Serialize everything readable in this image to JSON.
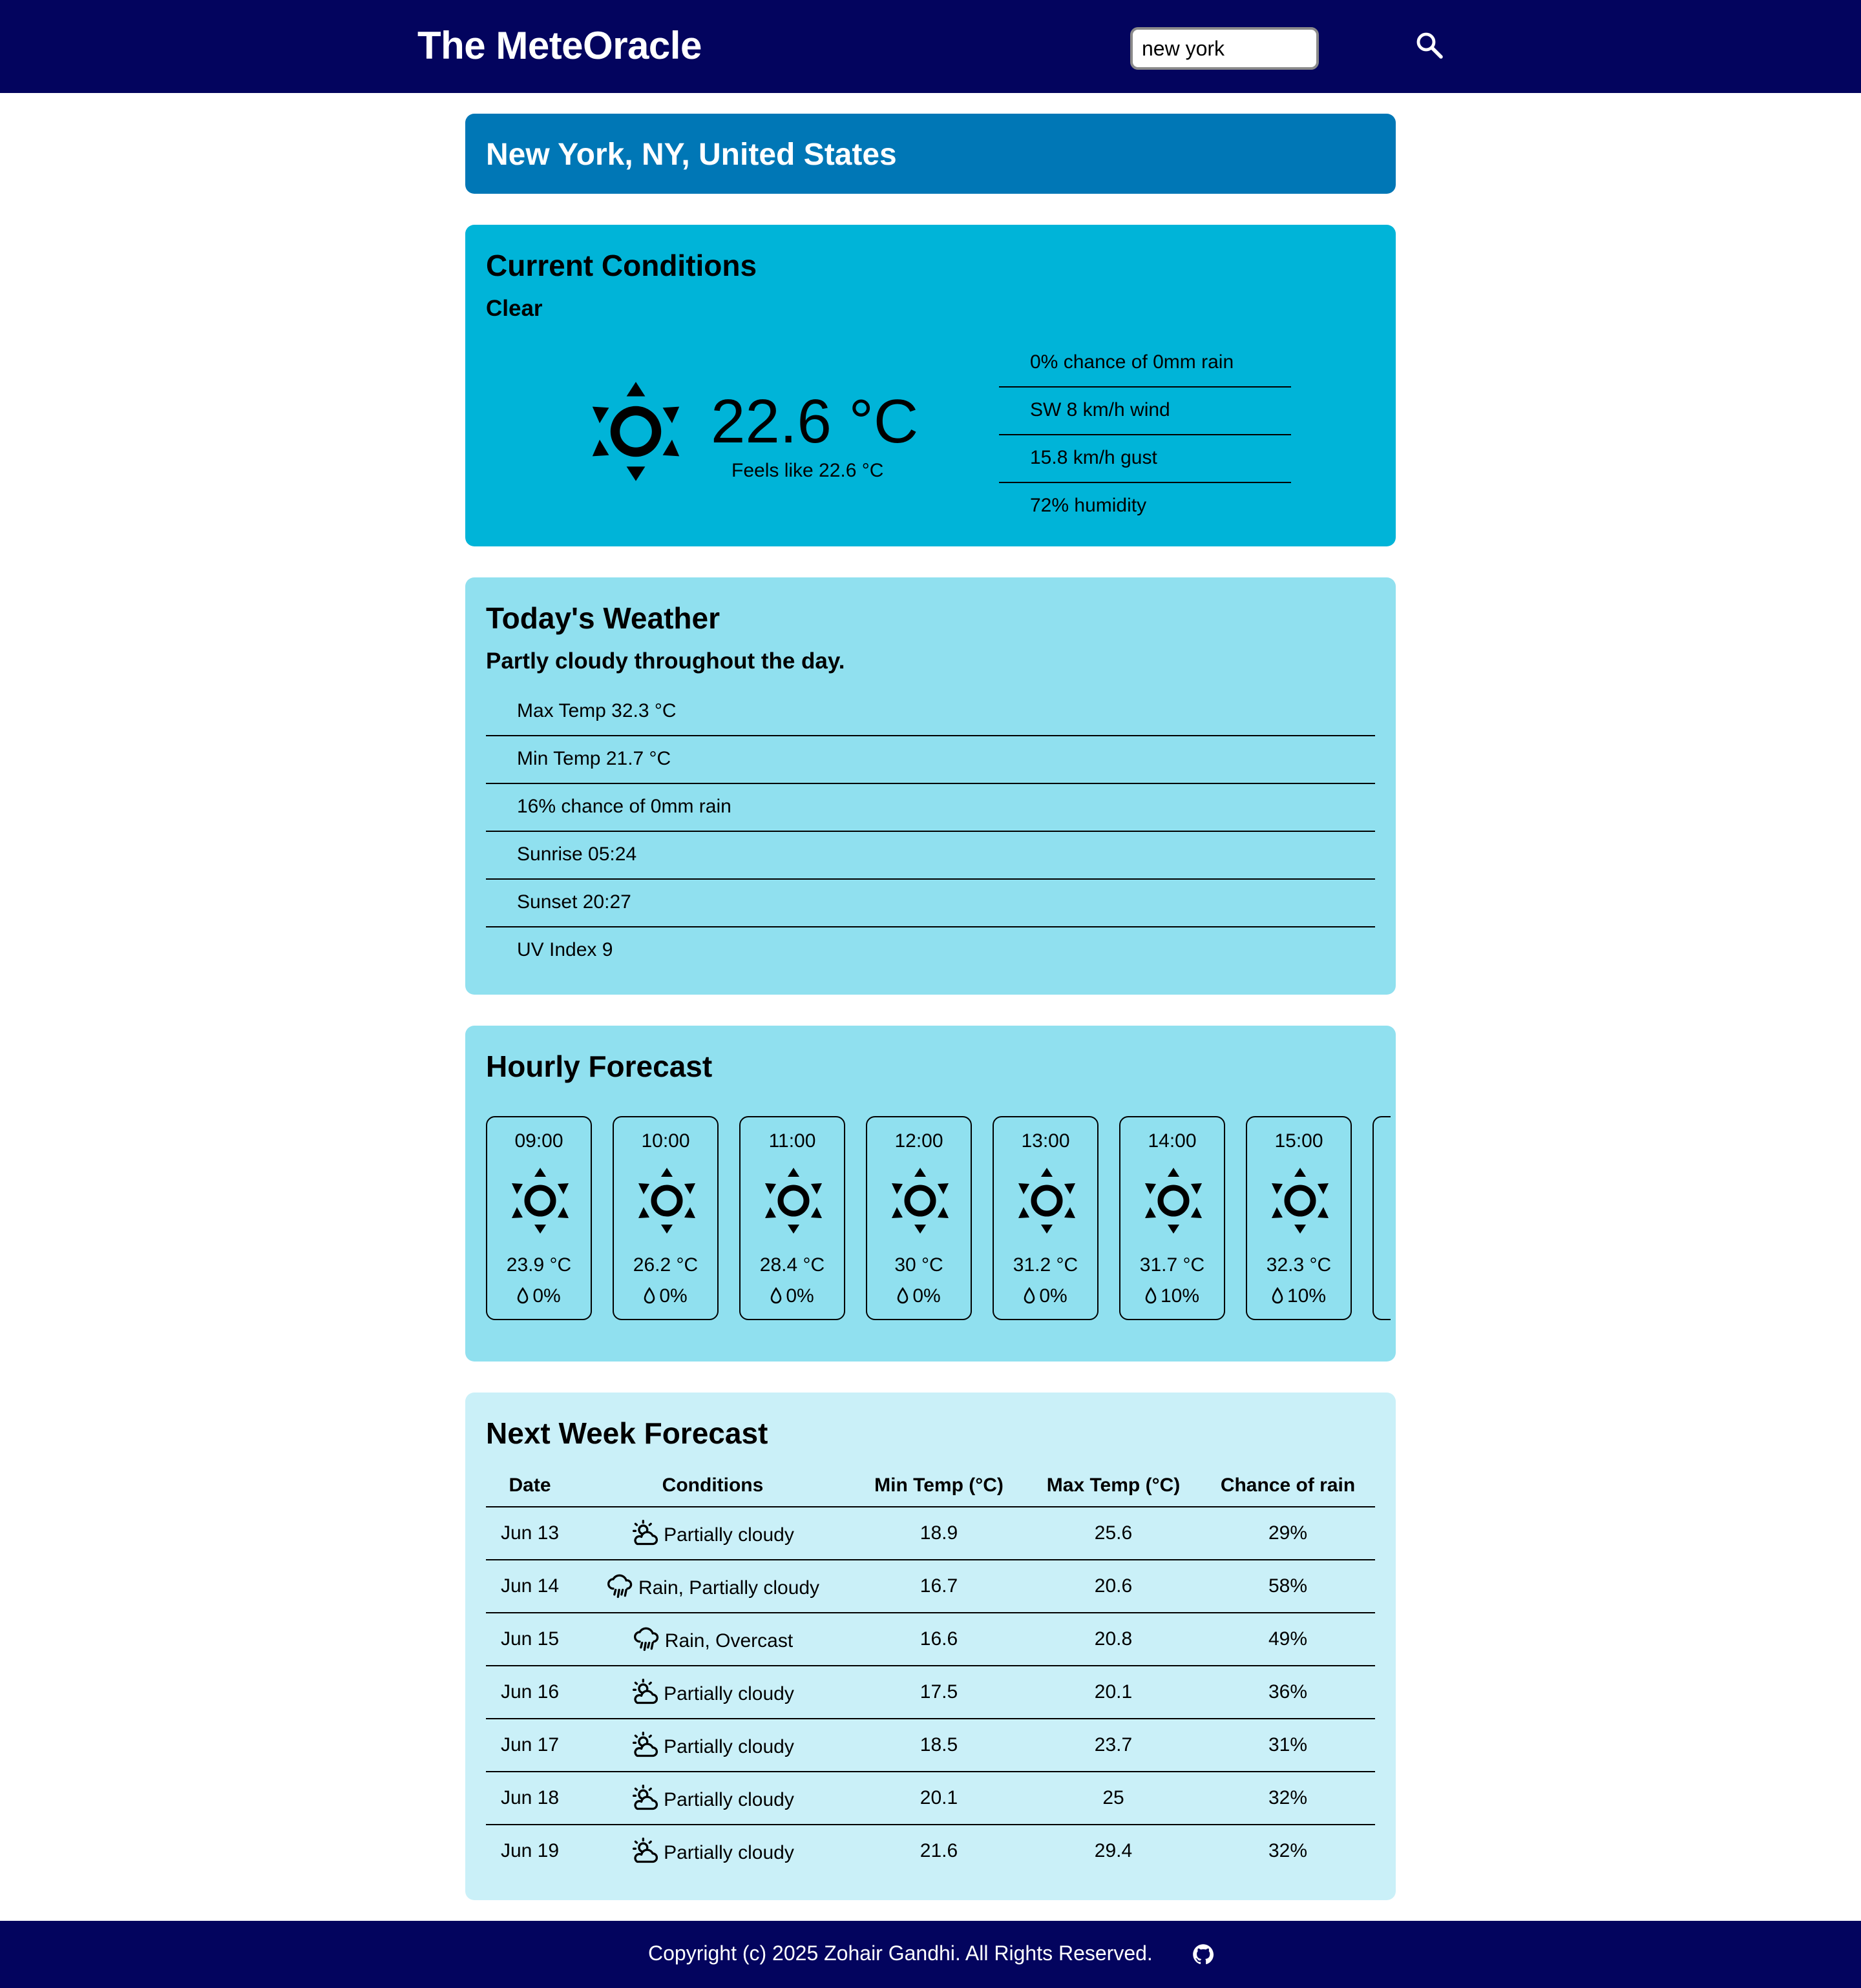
{
  "header": {
    "brand": "The MeteOracle",
    "search_value": "new york",
    "search_icon": "search-icon"
  },
  "location": "New York, NY, United States",
  "current": {
    "title": "Current Conditions",
    "condition": "Clear",
    "icon": "sun-icon",
    "temp": "22.6 °C",
    "feels_like": "Feels like 22.6 °C",
    "details": [
      "0% chance of 0mm rain",
      "SW 8 km/h wind",
      "15.8 km/h gust",
      "72% humidity"
    ]
  },
  "today": {
    "title": "Today's Weather",
    "summary": "Partly cloudy throughout the day.",
    "details": [
      "Max Temp 32.3 °C",
      "Min Temp 21.7 °C",
      "16% chance of 0mm rain",
      "Sunrise 05:24",
      "Sunset 20:27",
      "UV Index 9"
    ]
  },
  "hourly": {
    "title": "Hourly Forecast",
    "hours": [
      {
        "time": "09:00",
        "temp": "23.9 °C",
        "rain": "0%",
        "icon": "sun-icon"
      },
      {
        "time": "10:00",
        "temp": "26.2 °C",
        "rain": "0%",
        "icon": "sun-icon"
      },
      {
        "time": "11:00",
        "temp": "28.4 °C",
        "rain": "0%",
        "icon": "sun-icon"
      },
      {
        "time": "12:00",
        "temp": "30 °C",
        "rain": "0%",
        "icon": "sun-icon"
      },
      {
        "time": "13:00",
        "temp": "31.2 °C",
        "rain": "0%",
        "icon": "sun-icon"
      },
      {
        "time": "14:00",
        "temp": "31.7 °C",
        "rain": "10%",
        "icon": "sun-icon"
      },
      {
        "time": "15:00",
        "temp": "32.3 °C",
        "rain": "10%",
        "icon": "sun-icon"
      }
    ]
  },
  "week": {
    "title": "Next Week Forecast",
    "headers": [
      "Date",
      "Conditions",
      "Min Temp (°C)",
      "Max Temp (°C)",
      "Chance of rain"
    ],
    "rows": [
      {
        "date": "Jun 13",
        "icon": "partly-cloudy-icon",
        "conditions": "Partially cloudy",
        "min": "18.9",
        "max": "25.6",
        "rain": "29%"
      },
      {
        "date": "Jun 14",
        "icon": "rain-icon",
        "conditions": "Rain, Partially cloudy",
        "min": "16.7",
        "max": "20.6",
        "rain": "58%"
      },
      {
        "date": "Jun 15",
        "icon": "rain-icon",
        "conditions": "Rain, Overcast",
        "min": "16.6",
        "max": "20.8",
        "rain": "49%"
      },
      {
        "date": "Jun 16",
        "icon": "partly-cloudy-icon",
        "conditions": "Partially cloudy",
        "min": "17.5",
        "max": "20.1",
        "rain": "36%"
      },
      {
        "date": "Jun 17",
        "icon": "partly-cloudy-icon",
        "conditions": "Partially cloudy",
        "min": "18.5",
        "max": "23.7",
        "rain": "31%"
      },
      {
        "date": "Jun 18",
        "icon": "partly-cloudy-icon",
        "conditions": "Partially cloudy",
        "min": "20.1",
        "max": "25",
        "rain": "32%"
      },
      {
        "date": "Jun 19",
        "icon": "partly-cloudy-icon",
        "conditions": "Partially cloudy",
        "min": "21.6",
        "max": "29.4",
        "rain": "32%"
      }
    ]
  },
  "footer": {
    "copyright": "Copyright (c) 2025 Zohair Gandhi. All Rights Reserved.",
    "icon": "github-icon"
  },
  "colors": {
    "header_bg": "#03045e",
    "location_bg": "#0077b6",
    "current_bg": "#00b4d8",
    "today_bg": "#90e0ef",
    "week_bg": "#caf0f8"
  }
}
